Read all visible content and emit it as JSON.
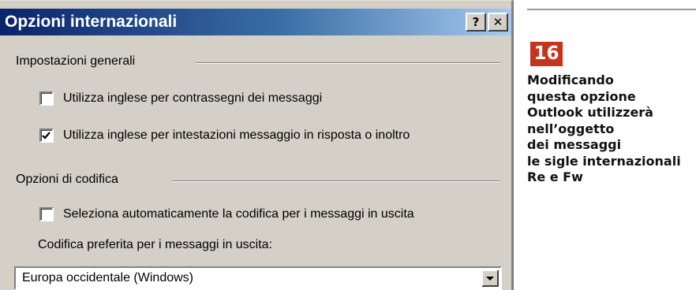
{
  "dialog": {
    "title": "Opzioni internazionali",
    "help_button": "?",
    "close_button": "✕",
    "groups": {
      "general": {
        "label": "Impostazioni generali",
        "options": [
          {
            "label": "Utilizza inglese per contrassegni dei messaggi",
            "checked": false
          },
          {
            "label": "Utilizza inglese per intestazioni messaggio in risposta o inoltro",
            "checked": true
          }
        ]
      },
      "encoding": {
        "label": "Opzioni di codifica",
        "options": [
          {
            "label": "Seleziona automaticamente la codifica per i messaggi in uscita",
            "checked": false
          }
        ],
        "preferred_label": "Codifica preferita per i messaggi in uscita:",
        "preferred_value": "Europa occidentale (Windows)"
      }
    },
    "colors": {
      "face": "#d4d0c8",
      "title_start": "#0a246a",
      "title_end": "#a6caf0"
    }
  },
  "caption": {
    "number": "16",
    "lines": [
      "Modificando",
      "questa opzione",
      "Outlook utilizzerà",
      "nell’oggetto",
      "dei messaggi",
      "le sigle internazionali",
      "Re e Fw"
    ],
    "colors": {
      "badge": "#c5351d",
      "text": "#111111"
    }
  }
}
